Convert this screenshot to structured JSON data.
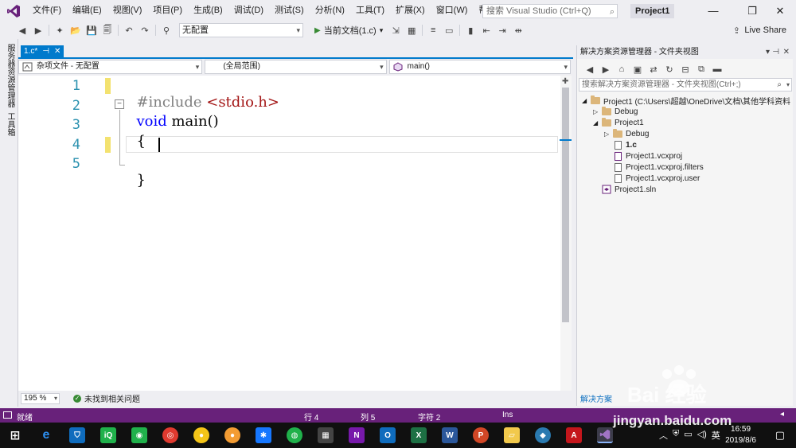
{
  "menu": [
    "文件(F)",
    "编辑(E)",
    "视图(V)",
    "项目(P)",
    "生成(B)",
    "调试(D)",
    "测试(S)",
    "分析(N)",
    "工具(T)",
    "扩展(X)",
    "窗口(W)",
    "帮助(H)"
  ],
  "quick_launch": {
    "placeholder": "搜索 Visual Studio (Ctrl+Q)"
  },
  "project_badge": "Project1",
  "toolbar": {
    "config": "无配置",
    "run_label": "当前文档(1.c)",
    "live_share": "Live Share"
  },
  "left_strip": {
    "tab1": "服务器资源管理器",
    "tab2": "工具箱"
  },
  "doc_tab": {
    "label": "1.c*",
    "pin": "⊣",
    "close": "✕"
  },
  "navbar": {
    "project_scope": "杂项文件 - 无配置",
    "scope": "(全局范围)",
    "member": "main()"
  },
  "code": {
    "line_numbers": [
      "1",
      "2",
      "3",
      "4",
      "5"
    ],
    "l1_pp": "#include",
    "l1_str": "<stdio.h>",
    "l2_kw": "void",
    "l2_rest": "main()",
    "l3": "{",
    "l5": "}"
  },
  "editor_footer": {
    "zoom": "195 %",
    "issues": "未找到相关问题"
  },
  "solution_explorer": {
    "title": "解决方案资源管理器 - 文件夹视图",
    "search_placeholder": "搜索解决方案资源管理器 - 文件夹视图(Ctrl+;)",
    "tree": [
      {
        "label": "Project1 (C:\\Users\\超越\\OneDrive\\文档\\其他学科资料",
        "icon": "folder-icon"
      },
      {
        "label": "Debug",
        "icon": "folder-icon"
      },
      {
        "label": "Project1",
        "icon": "folder-icon"
      },
      {
        "label": "Debug",
        "icon": "folder-icon"
      },
      {
        "label": "1.c",
        "icon": "c-file-icon"
      },
      {
        "label": "Project1.vcxproj",
        "icon": "project-file-icon"
      },
      {
        "label": "Project1.vcxproj.filters",
        "icon": "file-icon"
      },
      {
        "label": "Project1.vcxproj.user",
        "icon": "file-icon"
      },
      {
        "label": "Project1.sln",
        "icon": "solution-icon"
      }
    ],
    "bottom_tab": "解决方案"
  },
  "statusbar": {
    "ready": "就绪",
    "line": "行 4",
    "col": "列 5",
    "char": "字符 2",
    "ins": "Ins"
  },
  "taskbar": {
    "time": "16:59",
    "date": "2019/8/6",
    "ime": "英"
  },
  "watermark": {
    "url": "jingyan.baidu.com",
    "logo_text": "Bai 经验"
  },
  "colors": {
    "accent": "#007acc",
    "statusbar": "#68217a",
    "change_marker": "#f3e270"
  }
}
